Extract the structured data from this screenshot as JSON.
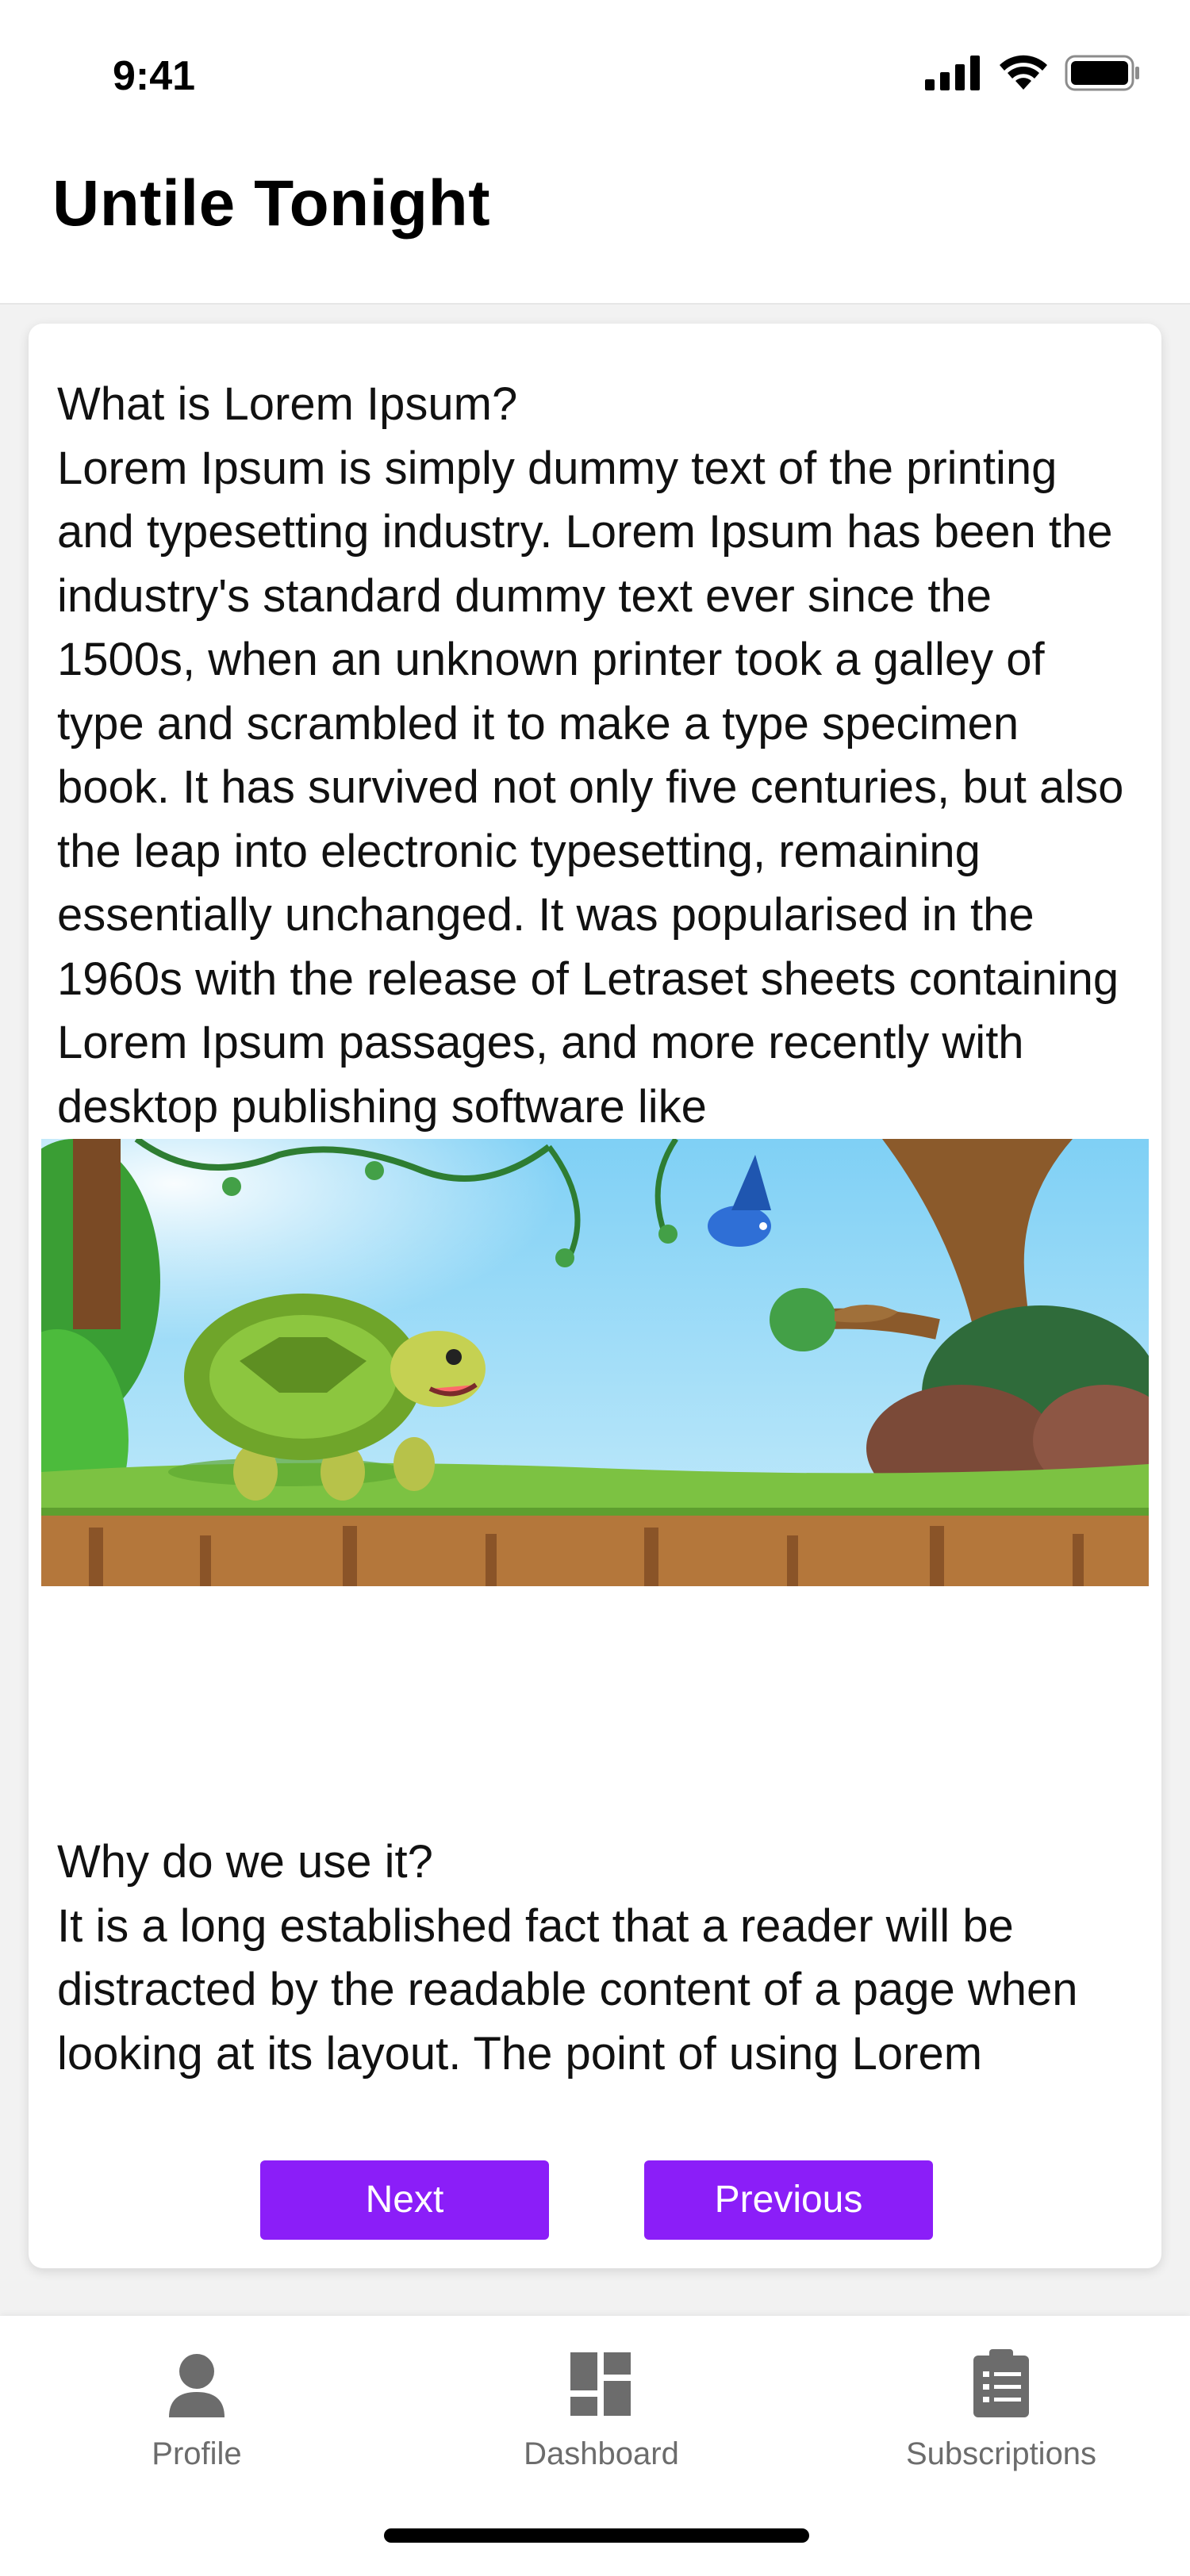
{
  "status_bar": {
    "time": "9:41",
    "icons": [
      "cellular-signal-icon",
      "wifi-icon",
      "battery-icon"
    ]
  },
  "header": {
    "title": "Untile Tonight"
  },
  "content": {
    "section1": {
      "heading": "What is Lorem Ipsum?",
      "body": "Lorem Ipsum is simply dummy text of the printing and typesetting industry. Lorem Ipsum has been the industry's standard dummy text ever since the 1500s, when an unknown printer took a galley of type and scrambled it to make a type specimen book. It has survived not only five centuries, but also the leap into electronic typesetting, remaining essentially unchanged. It was popularised in the 1960s with the release of Letraset sheets containing Lorem Ipsum passages, and more recently with desktop publishing software like"
    },
    "illustration": {
      "icon": "turtle-forest-illustration"
    },
    "section2": {
      "heading": "Why do we use it?",
      "body": "It is a long established fact that a reader will be distracted by the readable content of a page when looking at its layout. The point of using Lorem"
    },
    "buttons": {
      "next_label": "Next",
      "previous_label": "Previous",
      "color": "#8b1ef8"
    }
  },
  "bottom_nav": {
    "items": [
      {
        "label": "Profile",
        "icon": "person-icon"
      },
      {
        "label": "Dashboard",
        "icon": "dashboard-grid-icon"
      },
      {
        "label": "Subscriptions",
        "icon": "clipboard-list-icon"
      }
    ]
  }
}
